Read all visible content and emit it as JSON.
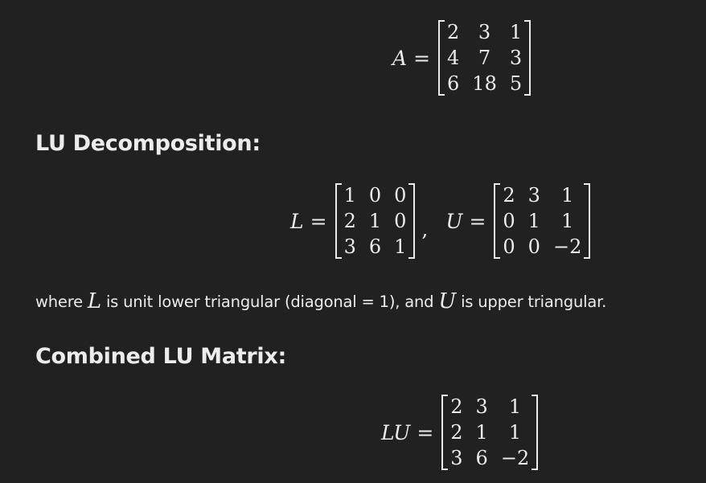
{
  "equation_a": {
    "lhs": "A",
    "rel": "=",
    "matrix": [
      [
        "2",
        "3",
        "1"
      ],
      [
        "4",
        "7",
        "3"
      ],
      [
        "6",
        "18",
        "5"
      ]
    ]
  },
  "section_lu": {
    "heading": "LU Decomposition:"
  },
  "equation_lu": {
    "l_lhs": "L",
    "l_rel": "=",
    "l_matrix": [
      [
        "1",
        "0",
        "0"
      ],
      [
        "2",
        "1",
        "0"
      ],
      [
        "3",
        "6",
        "1"
      ]
    ],
    "separator": ",",
    "u_lhs": "U",
    "u_rel": "=",
    "u_matrix": [
      [
        "2",
        "3",
        "1"
      ],
      [
        "0",
        "1",
        "1"
      ],
      [
        "0",
        "0",
        "−2"
      ]
    ]
  },
  "explanation": {
    "part1": "where ",
    "var1": "L",
    "part2": " is unit lower triangular (diagonal = 1), and ",
    "var2": "U",
    "part3": " is upper triangular."
  },
  "section_combined": {
    "heading": "Combined LU Matrix:"
  },
  "equation_combined": {
    "lhs": "LU",
    "rel": "=",
    "matrix": [
      [
        "2",
        "3",
        "1"
      ],
      [
        "2",
        "1",
        "1"
      ],
      [
        "3",
        "6",
        "−2"
      ]
    ]
  }
}
